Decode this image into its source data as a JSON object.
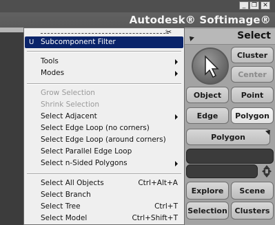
{
  "window": {
    "minimize_glyph": "_",
    "restore_glyph": "❐",
    "close_glyph": "✕"
  },
  "header": {
    "brand": "Autodesk® Softimage®"
  },
  "panel": {
    "title": "Select",
    "buttons": {
      "cluster": "Cluster",
      "center": "Center",
      "object": "Object",
      "point": "Point",
      "edge": "Edge",
      "polygon": "Polygon",
      "polygon_filter": "Polygon",
      "explore": "Explore",
      "scene": "Scene",
      "selection": "Selection",
      "clusters": "Clusters"
    }
  },
  "menu": {
    "scissors_glyph": "✂",
    "groups": [
      {
        "items": [
          {
            "key": "U",
            "label": "Subcomponent Filter",
            "shortcut": "",
            "submenu": false,
            "disabled": false,
            "selected": true
          }
        ]
      },
      {
        "items": [
          {
            "label": "Tools",
            "shortcut": "",
            "submenu": true,
            "disabled": false
          },
          {
            "label": "Modes",
            "shortcut": "",
            "submenu": true,
            "disabled": false
          }
        ]
      },
      {
        "items": [
          {
            "label": "Grow Selection",
            "shortcut": "",
            "submenu": false,
            "disabled": true
          },
          {
            "label": "Shrink Selection",
            "shortcut": "",
            "submenu": false,
            "disabled": true
          },
          {
            "label": "Select Adjacent",
            "shortcut": "",
            "submenu": true,
            "disabled": false
          },
          {
            "label": "Select Edge Loop (no corners)",
            "shortcut": "",
            "submenu": false,
            "disabled": false
          },
          {
            "label": "Select Edge Loop (around corners)",
            "shortcut": "",
            "submenu": false,
            "disabled": false
          },
          {
            "label": "Select Parallel Edge Loop",
            "shortcut": "",
            "submenu": false,
            "disabled": false
          },
          {
            "label": "Select n-Sided Polygons",
            "shortcut": "",
            "submenu": true,
            "disabled": false
          }
        ]
      },
      {
        "items": [
          {
            "label": "Select All Objects",
            "shortcut": "Ctrl+Alt+A",
            "submenu": false,
            "disabled": false
          },
          {
            "label": "Select Branch",
            "shortcut": "",
            "submenu": false,
            "disabled": false
          },
          {
            "label": "Select Tree",
            "shortcut": "Ctrl+T",
            "submenu": false,
            "disabled": false
          },
          {
            "label": "Select Model",
            "shortcut": "Ctrl+Shift+T",
            "submenu": false,
            "disabled": false
          }
        ]
      }
    ]
  }
}
